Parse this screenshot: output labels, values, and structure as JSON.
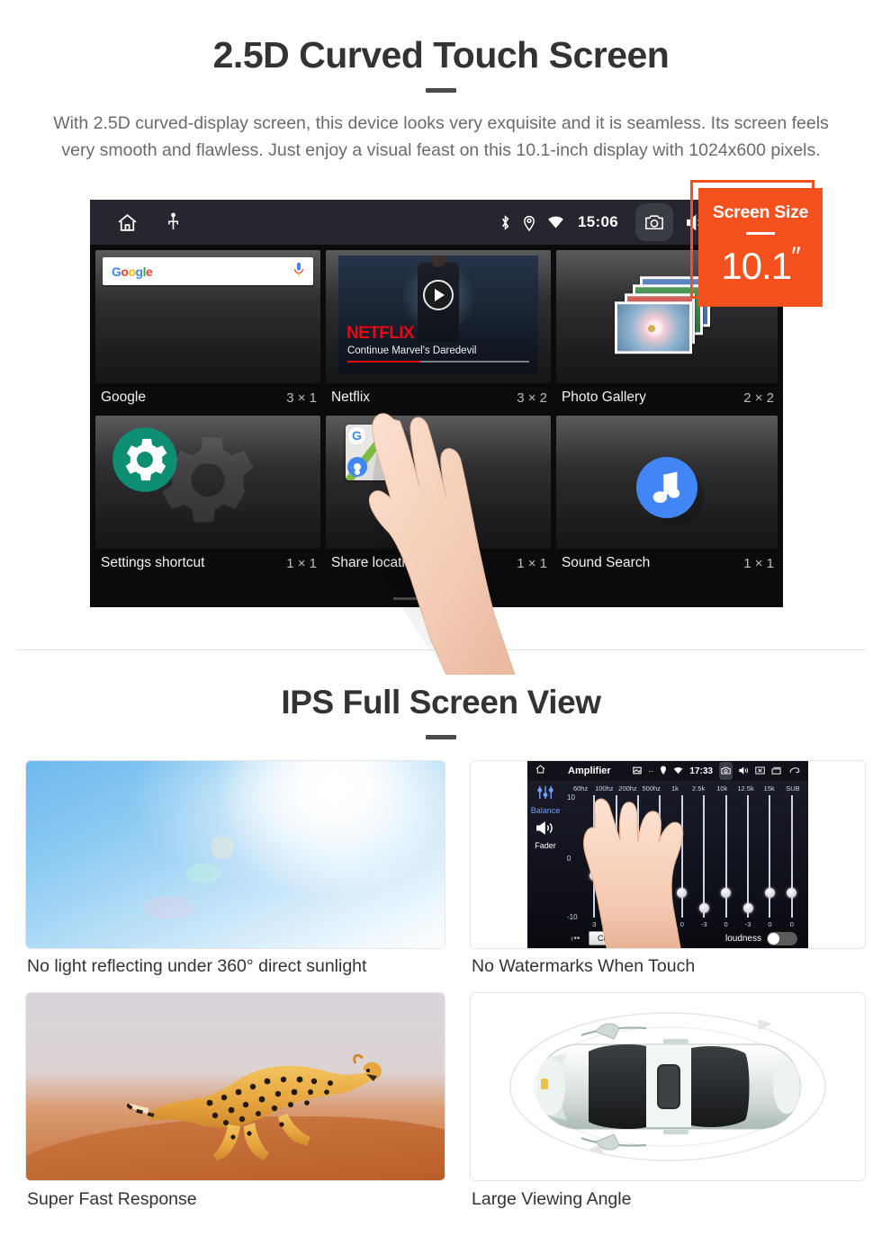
{
  "section1": {
    "title": "2.5D Curved Touch Screen",
    "description": "With 2.5D curved-display screen, this device looks very exquisite and it is seamless. Its screen feels very smooth and flawless. Just enjoy a visual feast on this 10.1-inch display with 1024x600 pixels."
  },
  "badge": {
    "label": "Screen Size",
    "value": "10.1",
    "unit": "″",
    "color": "#f4511e"
  },
  "device": {
    "statusbar": {
      "time": "15:06",
      "left_icons": [
        "home-icon",
        "usb-icon"
      ],
      "right_icons": [
        "bluetooth-icon",
        "location-icon",
        "wifi-icon",
        "camera-icon",
        "volume-icon",
        "close-box-icon",
        "recents-icon"
      ]
    },
    "widgets": [
      {
        "name": "Google",
        "size": "3 × 1",
        "search_placeholder": "Google",
        "logo": "Google",
        "mic": "mic-icon"
      },
      {
        "name": "Netflix",
        "size": "3 × 2",
        "brand": "NETFLIX",
        "subtitle": "Continue Marvel's Daredevil"
      },
      {
        "name": "Photo Gallery",
        "size": "2 × 2"
      },
      {
        "name": "Settings shortcut",
        "size": "1 × 1"
      },
      {
        "name": "Share location",
        "size": "1 × 1"
      },
      {
        "name": "Sound Search",
        "size": "1 × 1"
      }
    ],
    "page_dots": 3,
    "active_dot": 3
  },
  "section2": {
    "title": "IPS Full Screen View",
    "cards": [
      {
        "caption": "No light reflecting under 360° direct sunlight"
      },
      {
        "caption": "No Watermarks When Touch"
      },
      {
        "caption": "Super Fast Response"
      },
      {
        "caption": "Large Viewing Angle"
      }
    ]
  },
  "amplifier": {
    "title": "Amplifier",
    "time": "17:33",
    "side": {
      "balance": "Balance",
      "fader": "Fader"
    },
    "scale": {
      "top": "10",
      "mid": "0",
      "bottom": "-10"
    },
    "bands": [
      "60hz",
      "100hz",
      "200hz",
      "500hz",
      "1k",
      "2.5k",
      "10k",
      "12.5k",
      "15k",
      "SUB"
    ],
    "values": [
      "3",
      "-4",
      "0",
      "0",
      "0",
      "-3",
      "0",
      "-3",
      "0",
      "0"
    ],
    "preset_label": "Custom",
    "loudness_label": "loudness",
    "loudness_on": false
  }
}
